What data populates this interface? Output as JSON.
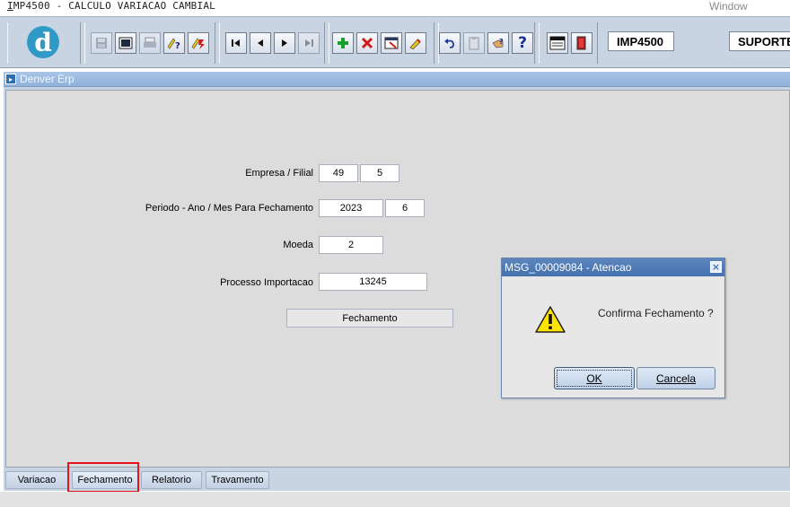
{
  "window": {
    "title_prefix": "I",
    "title_rest": "MP4500 - CALCULO VARIACAO CAMBIAL",
    "menu_window": "Window"
  },
  "toolbar": {
    "logo_letter": "d",
    "module_code": "IMP4500",
    "user": "SUPORTE(",
    "icons": [
      "save-icon",
      "print-preview-icon",
      "print-icon",
      "query-icon",
      "execute-query-icon",
      "first-record-icon",
      "previous-record-icon",
      "next-record-icon",
      "last-record-icon",
      "insert-record-icon",
      "delete-record-icon",
      "clear-record-icon",
      "edit-icon",
      "undo-icon",
      "clipboard-icon",
      "help-hand-icon",
      "help-icon",
      "menu-icon",
      "exit-icon"
    ]
  },
  "inner_window": {
    "title": "Denver Erp"
  },
  "form": {
    "empresa_label": "Empresa / Filial",
    "empresa_value": "49",
    "filial_value": "5",
    "periodo_label": "Periodo - Ano / Mes Para Fechamento",
    "ano_value": "2023",
    "mes_value": "6",
    "moeda_label": "Moeda",
    "moeda_value": "2",
    "processo_label": "Processo Importacao",
    "processo_value": "13245",
    "fechamento_button": "Fechamento"
  },
  "tabs": [
    {
      "label": "Variacao",
      "active": false
    },
    {
      "label": "Fechamento",
      "active": true
    },
    {
      "label": "Relatorio",
      "active": false
    },
    {
      "label": "Travamento",
      "active": false
    }
  ],
  "dialog": {
    "title": "MSG_00009084 - Atencao",
    "message": "Confirma Fechamento ?",
    "ok_label": "OK",
    "cancel_label": "Cancela",
    "icon": "warning-icon"
  },
  "colors": {
    "toolbar_bg": "#c9d4e3",
    "dialog_title": "#4572ad",
    "highlight": "#e3151c",
    "logo": "#2f9ac6"
  }
}
